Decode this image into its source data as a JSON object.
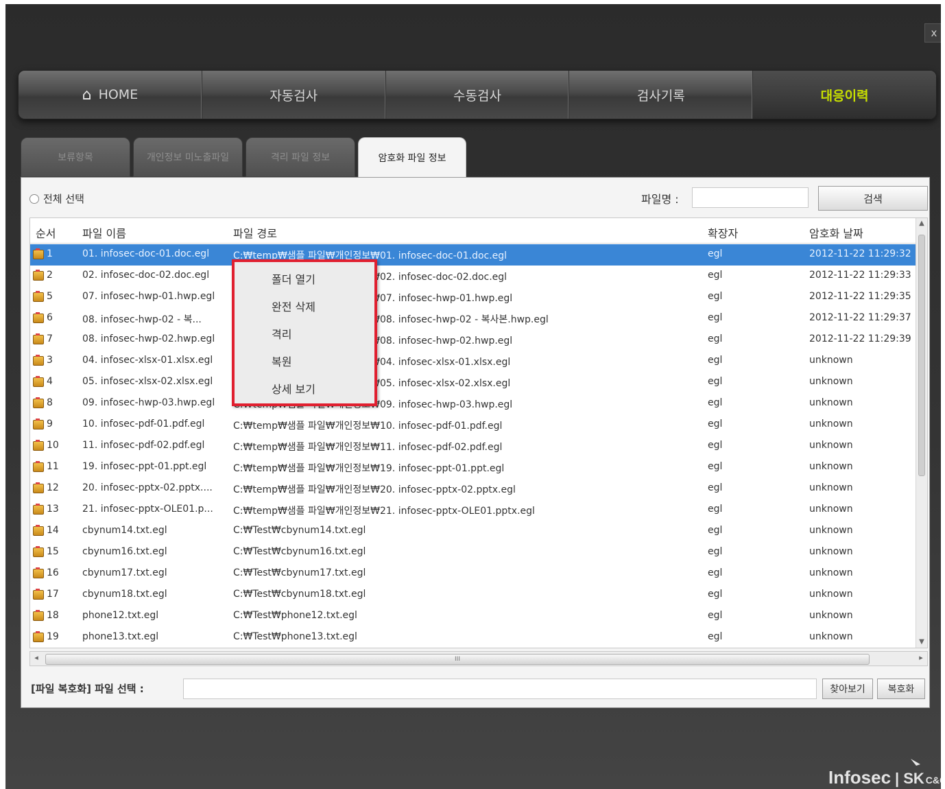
{
  "window": {
    "close_glyph": "x"
  },
  "nav": {
    "items": [
      {
        "label": "HOME",
        "icon": "home-icon"
      },
      {
        "label": "자동검사"
      },
      {
        "label": "수동검사"
      },
      {
        "label": "검사기록"
      },
      {
        "label": "대응이력",
        "active": true
      }
    ],
    "active_color": "#c8e000"
  },
  "subtabs": [
    {
      "label": "보류항목"
    },
    {
      "label": "개인정보 미노출파일"
    },
    {
      "label": "격리 파일 정보"
    },
    {
      "label": "암호화 파일 정보",
      "active": true
    }
  ],
  "toolbar": {
    "select_all_label": "전체 선택",
    "filename_label": "파일명 :",
    "filename_value": "",
    "search_label": "검색"
  },
  "table": {
    "columns": [
      "순서",
      "파일 이름",
      "파일 경로",
      "확장자",
      "암호화 날짜"
    ],
    "rows": [
      {
        "order": "1",
        "name": "01. infosec-doc-01.doc.egl",
        "path": "C:₩temp₩샘플 파일₩개인정보₩01. infosec-doc-01.doc.egl",
        "ext": "egl",
        "date": "2012-11-22 11:29:32",
        "selected": true
      },
      {
        "order": "2",
        "name": "02. infosec-doc-02.doc.egl",
        "path": "C:₩temp₩샘플 파일₩개인정보₩02. infosec-doc-02.doc.egl",
        "ext": "egl",
        "date": "2012-11-22 11:29:33"
      },
      {
        "order": "5",
        "name": "07. infosec-hwp-01.hwp.egl",
        "path": "C:₩temp₩샘플 파일₩개인정보₩07. infosec-hwp-01.hwp.egl",
        "ext": "egl",
        "date": "2012-11-22 11:29:35"
      },
      {
        "order": "6",
        "name": "08. infosec-hwp-02 - 복...",
        "path": "C:₩temp₩샘플 파일₩개인정보₩08. infosec-hwp-02 - 복사본.hwp.egl",
        "ext": "egl",
        "date": "2012-11-22 11:29:37"
      },
      {
        "order": "7",
        "name": "08. infosec-hwp-02.hwp.egl",
        "path": "C:₩temp₩샘플 파일₩개인정보₩08. infosec-hwp-02.hwp.egl",
        "ext": "egl",
        "date": "2012-11-22 11:29:39"
      },
      {
        "order": "3",
        "name": "04. infosec-xlsx-01.xlsx.egl",
        "path": "C:₩temp₩샘플 파일₩개인정보₩04. infosec-xlsx-01.xlsx.egl",
        "ext": "egl",
        "date": "unknown"
      },
      {
        "order": "4",
        "name": "05. infosec-xlsx-02.xlsx.egl",
        "path": "C:₩temp₩샘플 파일₩개인정보₩05. infosec-xlsx-02.xlsx.egl",
        "ext": "egl",
        "date": "unknown"
      },
      {
        "order": "8",
        "name": "09. infosec-hwp-03.hwp.egl",
        "path": "C:₩temp₩샘플 파일₩개인정보₩09. infosec-hwp-03.hwp.egl",
        "ext": "egl",
        "date": "unknown"
      },
      {
        "order": "9",
        "name": "10. infosec-pdf-01.pdf.egl",
        "path": "C:₩temp₩샘플 파일₩개인정보₩10. infosec-pdf-01.pdf.egl",
        "ext": "egl",
        "date": "unknown"
      },
      {
        "order": "10",
        "name": "11. infosec-pdf-02.pdf.egl",
        "path": "C:₩temp₩샘플 파일₩개인정보₩11. infosec-pdf-02.pdf.egl",
        "ext": "egl",
        "date": "unknown"
      },
      {
        "order": "11",
        "name": "19. infosec-ppt-01.ppt.egl",
        "path": "C:₩temp₩샘플 파일₩개인정보₩19. infosec-ppt-01.ppt.egl",
        "ext": "egl",
        "date": "unknown"
      },
      {
        "order": "12",
        "name": "20. infosec-pptx-02.pptx....",
        "path": "C:₩temp₩샘플 파일₩개인정보₩20. infosec-pptx-02.pptx.egl",
        "ext": "egl",
        "date": "unknown"
      },
      {
        "order": "13",
        "name": "21. infosec-pptx-OLE01.p...",
        "path": "C:₩temp₩샘플 파일₩개인정보₩21. infosec-pptx-OLE01.pptx.egl",
        "ext": "egl",
        "date": "unknown"
      },
      {
        "order": "14",
        "name": "cbynum14.txt.egl",
        "path": "C:₩Test₩cbynum14.txt.egl",
        "ext": "egl",
        "date": "unknown"
      },
      {
        "order": "15",
        "name": "cbynum16.txt.egl",
        "path": "C:₩Test₩cbynum16.txt.egl",
        "ext": "egl",
        "date": "unknown"
      },
      {
        "order": "16",
        "name": "cbynum17.txt.egl",
        "path": "C:₩Test₩cbynum17.txt.egl",
        "ext": "egl",
        "date": "unknown"
      },
      {
        "order": "17",
        "name": "cbynum18.txt.egl",
        "path": "C:₩Test₩cbynum18.txt.egl",
        "ext": "egl",
        "date": "unknown"
      },
      {
        "order": "18",
        "name": "phone12.txt.egl",
        "path": "C:₩Test₩phone12.txt.egl",
        "ext": "egl",
        "date": "unknown"
      },
      {
        "order": "19",
        "name": "phone13.txt.egl",
        "path": "C:₩Test₩phone13.txt.egl",
        "ext": "egl",
        "date": "unknown"
      }
    ],
    "selected_color": "#3a86d6"
  },
  "hscroll": {
    "thumb_grip": "III"
  },
  "context_menu": {
    "items": [
      "폴더 열기",
      "완전 삭제",
      "격리",
      "복원",
      "상세 보기"
    ],
    "border_color": "#e02030"
  },
  "bottom": {
    "restore_label": "[파일 복호화] 파일 선택 :",
    "restore_value": "",
    "browse_label": "찾아보기",
    "restore_button_label": "복호화"
  },
  "brand": {
    "name": "Infosec",
    "separator": "|",
    "partner": "SK",
    "partner_sub": "C&C"
  }
}
